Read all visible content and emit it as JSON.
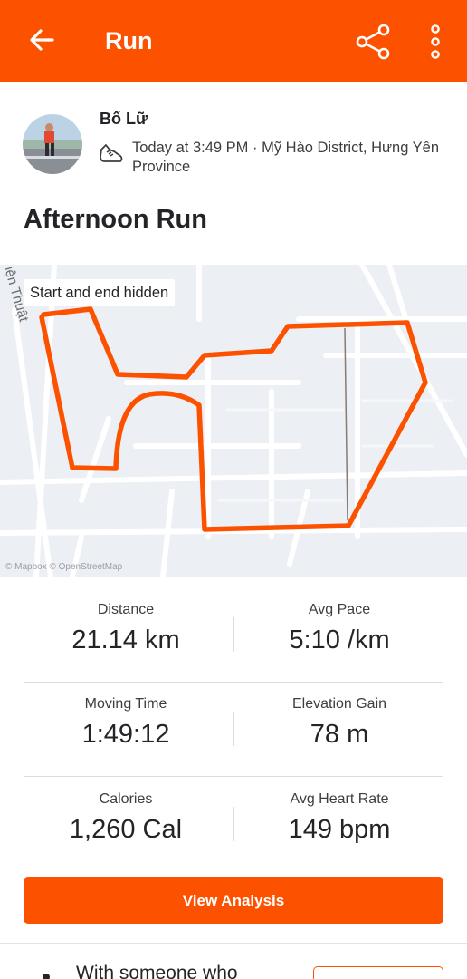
{
  "header": {
    "title": "Run",
    "accent_color": "#fc5200",
    "icons": [
      "arrow-back-icon",
      "share-icon",
      "more-vertical-icon"
    ]
  },
  "athlete": {
    "name": "Bố Lữ",
    "meta": "Today at 3:49 PM · Mỹ Hào District, Hưng Yên Province",
    "icon": "shoe-icon"
  },
  "activity": {
    "title": "Afternoon Run"
  },
  "map": {
    "badge": "Start and end hidden",
    "street_label": "iện Thuật",
    "attribution": "© Mapbox © OpenStreetMap",
    "route_color": "#fc5200"
  },
  "stats": [
    {
      "label": "Distance",
      "value": "21.14 km"
    },
    {
      "label": "Avg Pace",
      "value": "5:10 /km"
    },
    {
      "label": "Moving Time",
      "value": "1:49:12"
    },
    {
      "label": "Elevation Gain",
      "value": "78 m"
    },
    {
      "label": "Calories",
      "value": "1,260 Cal"
    },
    {
      "label": "Avg Heart Rate",
      "value": "149 bpm"
    }
  ],
  "actions": {
    "view_analysis": "View Analysis"
  },
  "footer": {
    "partial_text": "With someone who"
  }
}
